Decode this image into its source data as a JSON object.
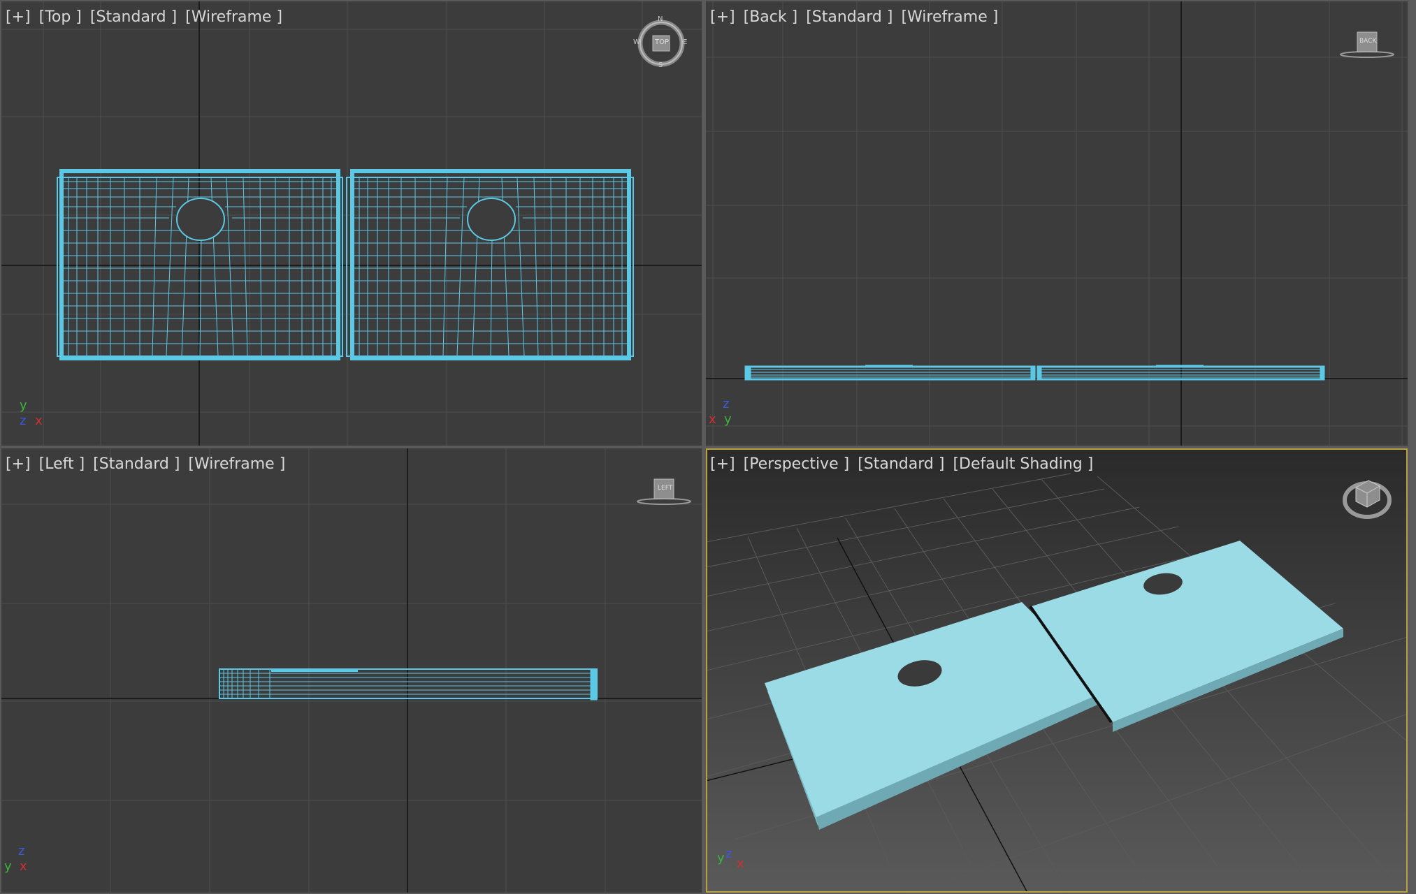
{
  "viewports": {
    "top": {
      "menu": "[+]",
      "view": "[Top ]",
      "shading_mode": "[Standard ]",
      "display": "[Wireframe ]"
    },
    "back": {
      "menu": "[+]",
      "view": "[Back ]",
      "shading_mode": "[Standard ]",
      "display": "[Wireframe ]"
    },
    "left": {
      "menu": "[+]",
      "view": "[Left ]",
      "shading_mode": "[Standard ]",
      "display": "[Wireframe ]"
    },
    "perspective": {
      "menu": "[+]",
      "view": "[Perspective ]",
      "shading_mode": "[Standard ]",
      "display": "[Default Shading ]"
    }
  },
  "viewcube": {
    "top_label": "TOP",
    "back_label": "BACK",
    "left_label": "LEFT",
    "compass": {
      "n": "N",
      "s": "S",
      "e": "E",
      "w": "W"
    }
  },
  "axes": {
    "top": {
      "up": "y",
      "center": "z",
      "right": "x"
    },
    "back": {
      "up": "z",
      "left": "x",
      "right": "y"
    },
    "left": {
      "up": "z",
      "left": "y",
      "right": "x"
    },
    "perspective": {
      "up": "z",
      "left": "y",
      "right": "x"
    }
  },
  "colors": {
    "viewport_bg": "#3c3c3c",
    "grid": "#4e4e4e",
    "grid_axis": "#111111",
    "wireframe": "#5bc8e6",
    "shaded": "#9adbe6",
    "active_border": "#b8a040",
    "axis_x": "#d03030",
    "axis_y": "#3cb43c",
    "axis_z": "#3c5adc"
  }
}
